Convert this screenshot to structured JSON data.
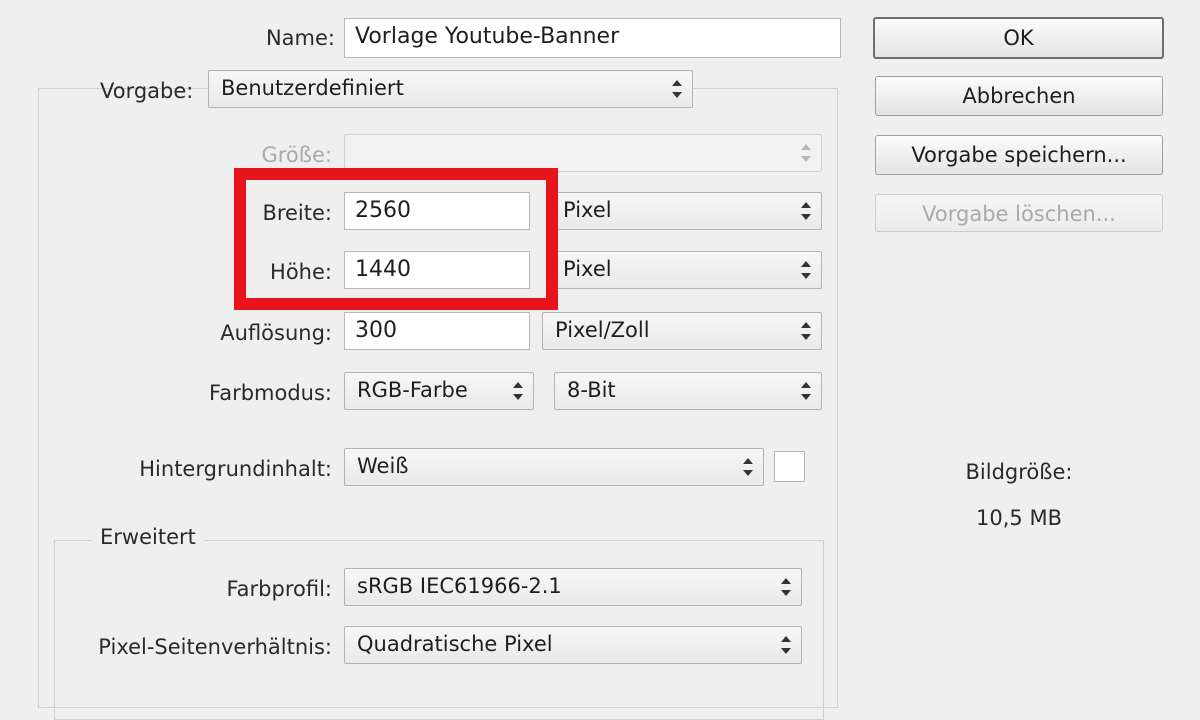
{
  "form": {
    "name_label": "Name:",
    "name_value": "Vorlage Youtube-Banner",
    "preset_label": "Vorgabe:",
    "preset_value": "Benutzerdefiniert",
    "size_label": "Größe:",
    "size_value": "",
    "width_label": "Breite:",
    "width_value": "2560",
    "width_unit": "Pixel",
    "height_label": "Höhe:",
    "height_value": "1440",
    "height_unit": "Pixel",
    "resolution_label": "Auflösung:",
    "resolution_value": "300",
    "resolution_unit": "Pixel/Zoll",
    "colormode_label": "Farbmodus:",
    "colormode_value": "RGB-Farbe",
    "bitdepth_value": "8-Bit",
    "background_label": "Hintergrundinhalt:",
    "background_value": "Weiß",
    "advanced_title": "Erweitert",
    "colorprofile_label": "Farbprofil:",
    "colorprofile_value": "sRGB IEC61966-2.1",
    "aspect_label": "Pixel-Seitenverhältnis:",
    "aspect_value": "Quadratische Pixel"
  },
  "buttons": {
    "ok": "OK",
    "cancel": "Abbrechen",
    "save_preset": "Vorgabe speichern...",
    "delete_preset": "Vorgabe löschen..."
  },
  "info": {
    "image_size_label": "Bildgröße:",
    "image_size_value": "10,5 MB"
  },
  "colors": {
    "highlight": "#e8141b",
    "background": "#efefef"
  },
  "icons": [
    "select-arrows-icon"
  ]
}
